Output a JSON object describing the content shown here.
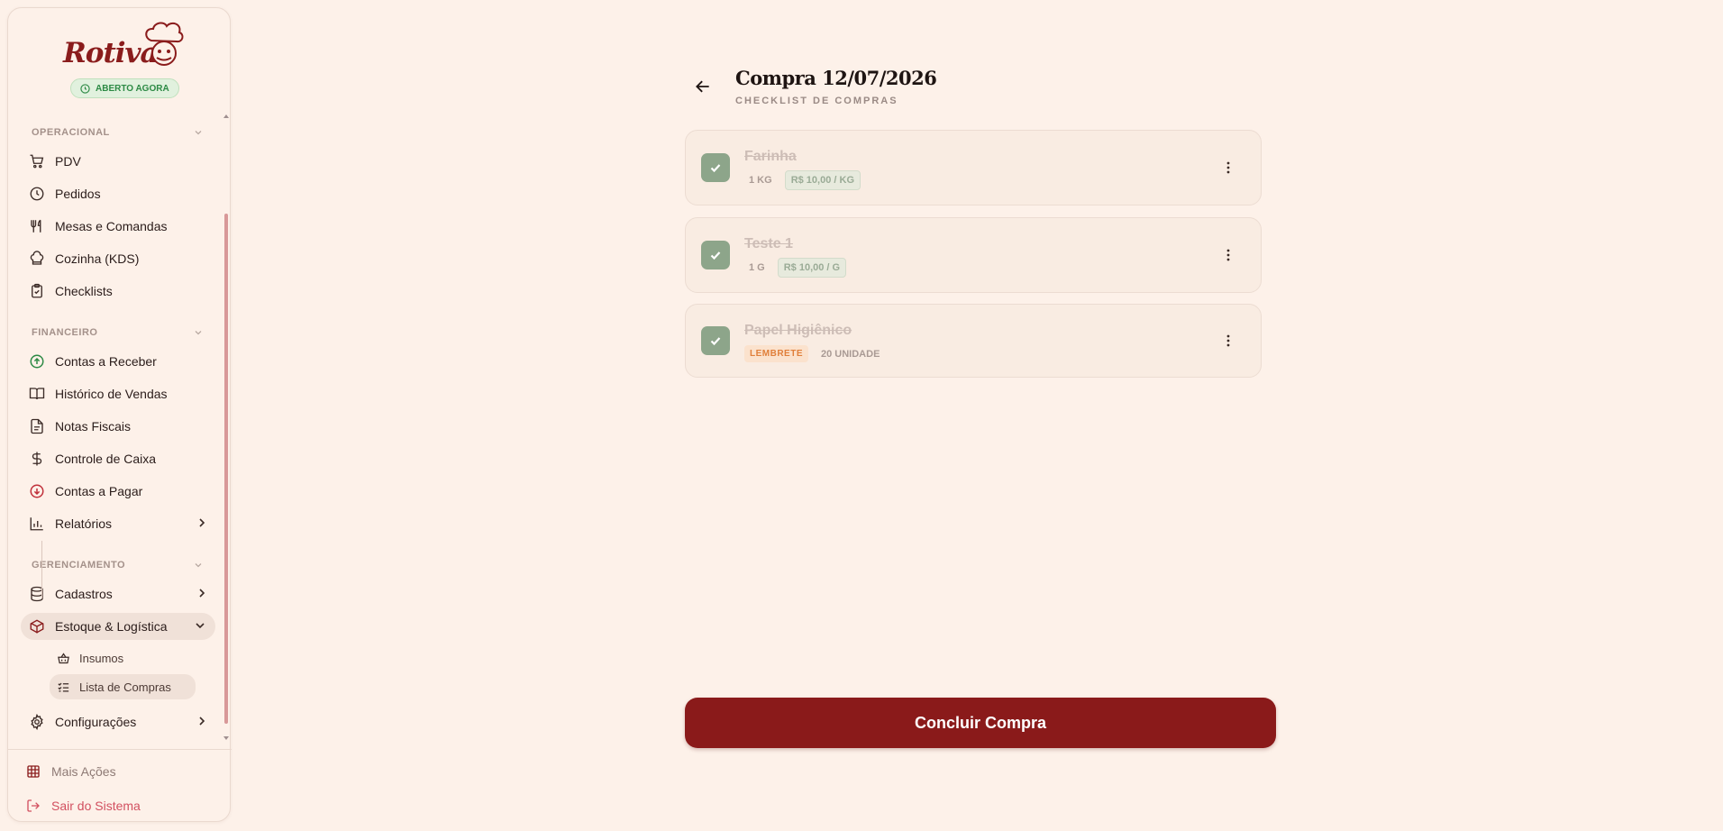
{
  "brand": {
    "name": "Rotiva",
    "status": "ABERTO AGORA"
  },
  "sidebar": {
    "sections": [
      {
        "label": "OPERACIONAL"
      },
      {
        "label": "FINANCEIRO"
      },
      {
        "label": "GERENCIAMENTO"
      }
    ],
    "operacional": [
      {
        "label": "PDV",
        "icon": "cart-icon"
      },
      {
        "label": "Pedidos",
        "icon": "clock-icon"
      },
      {
        "label": "Mesas e Comandas",
        "icon": "utensils-icon"
      },
      {
        "label": "Cozinha (KDS)",
        "icon": "chef-hat-icon"
      },
      {
        "label": "Checklists",
        "icon": "clipboard-check-icon"
      }
    ],
    "financeiro": [
      {
        "label": "Contas a Receber",
        "icon": "arrow-up-circle-icon"
      },
      {
        "label": "Histórico de Vendas",
        "icon": "book-open-icon"
      },
      {
        "label": "Notas Fiscais",
        "icon": "file-text-icon"
      },
      {
        "label": "Controle de Caixa",
        "icon": "dollar-icon"
      },
      {
        "label": "Contas a Pagar",
        "icon": "arrow-down-circle-icon"
      },
      {
        "label": "Relatórios",
        "icon": "bar-chart-icon"
      }
    ],
    "gerenciamento": [
      {
        "label": "Cadastros",
        "icon": "database-icon"
      },
      {
        "label": "Estoque & Logística",
        "icon": "package-icon"
      },
      {
        "label": "Configurações",
        "icon": "gear-icon"
      }
    ],
    "estoque_sub": [
      {
        "label": "Insumos",
        "icon": "basket-icon"
      },
      {
        "label": "Lista de Compras",
        "icon": "list-checks-icon"
      }
    ],
    "footer": {
      "mais": "Mais Ações",
      "sair": "Sair do Sistema"
    }
  },
  "page": {
    "title": "Compra 12/07/2026",
    "subtitle": "CHECKLIST DE COMPRAS"
  },
  "items": [
    {
      "name": "Farinha",
      "qty": "1 KG",
      "price": "R$ 10,00 / KG",
      "checked": true
    },
    {
      "name": "Teste 1",
      "qty": "1 G",
      "price": "R$ 10,00 / G",
      "checked": true
    },
    {
      "name": "Papel Higiênico",
      "tag": "LEMBRETE",
      "qty": "20 UNIDADE",
      "checked": true
    }
  ],
  "actions": {
    "conclude": "Concluir Compra"
  },
  "colors": {
    "brand": "#8a1a1a",
    "background": "#fdf1e9",
    "check": "#8da58a",
    "open": "#2d8a45",
    "logout": "#d25060"
  }
}
